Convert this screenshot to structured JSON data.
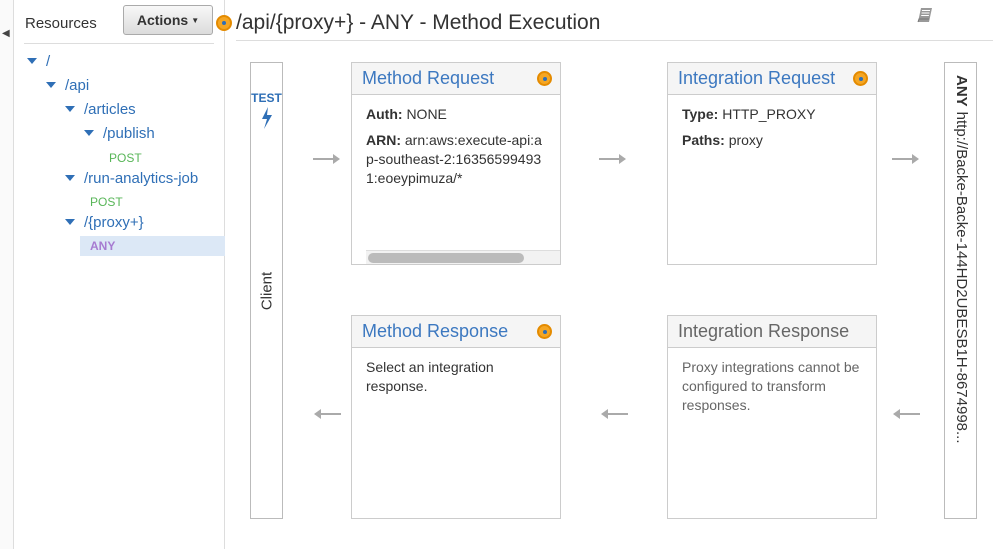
{
  "sidebar": {
    "title": "Resources",
    "actions_label": "Actions",
    "tree": [
      {
        "label": "/"
      },
      {
        "label": "/api"
      },
      {
        "label": "/articles"
      },
      {
        "label": "/publish"
      },
      {
        "method": "POST"
      },
      {
        "label": "/run-analytics-job"
      },
      {
        "method": "POST"
      },
      {
        "label": "/{proxy+}"
      },
      {
        "method": "ANY",
        "selected": true
      }
    ]
  },
  "header": {
    "title": "/api/{proxy+} - ANY - Method Execution"
  },
  "client": {
    "test_label": "TEST",
    "label": "Client"
  },
  "method_request": {
    "title": "Method Request",
    "auth_label": "Auth:",
    "auth_value": "NONE",
    "arn_label": "ARN:",
    "arn_value": "arn:aws:execute-api:ap-southeast-2:163565994931:eoeypimuza/*"
  },
  "integration_request": {
    "title": "Integration Request",
    "type_label": "Type:",
    "type_value": "HTTP_PROXY",
    "paths_label": "Paths:",
    "paths_value": "proxy"
  },
  "method_response": {
    "title": "Method Response",
    "text": "Select an integration response."
  },
  "integration_response": {
    "title": "Integration Response",
    "text": "Proxy integrations cannot be configured to transform responses."
  },
  "backend": {
    "method": "ANY",
    "endpoint": "http://Backe-Backe-144HD2UBESB1H-8674998..."
  },
  "colors": {
    "link_blue": "#3c78c0",
    "status_orange": "#f5a623",
    "post_green": "#58b658",
    "any_purple": "#a77bd1",
    "selected_bg": "#dce8f6"
  },
  "icons": [
    "collapse-left-icon",
    "status-dot-icon",
    "book-icon",
    "lightning-bolt-icon",
    "arrow-right-icon",
    "arrow-left-icon"
  ]
}
